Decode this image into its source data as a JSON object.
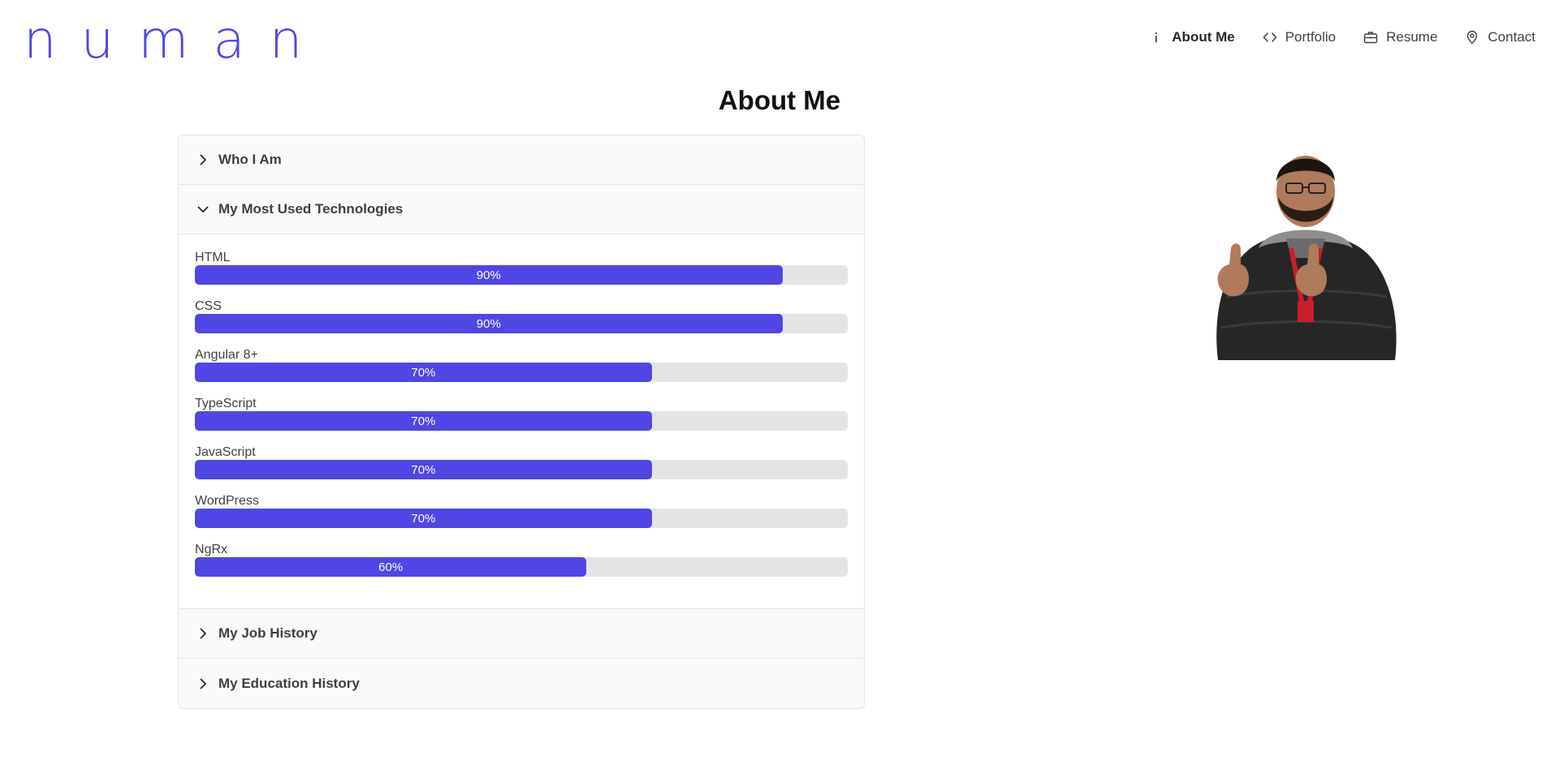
{
  "header": {
    "logo": "numan",
    "nav": [
      {
        "label": "About Me",
        "icon": "info-icon",
        "active": true
      },
      {
        "label": "Portfolio",
        "icon": "code-icon",
        "active": false
      },
      {
        "label": "Resume",
        "icon": "briefcase-icon",
        "active": false
      },
      {
        "label": "Contact",
        "icon": "map-pin-icon",
        "active": false
      }
    ]
  },
  "main": {
    "title": "About Me",
    "sections": [
      {
        "label": "Who I Am",
        "expanded": false
      },
      {
        "label": "My Most Used Technologies",
        "expanded": true
      },
      {
        "label": "My Job History",
        "expanded": false
      },
      {
        "label": "My Education History",
        "expanded": false
      }
    ],
    "skills": [
      {
        "name": "HTML",
        "percent": 90,
        "label": "90%"
      },
      {
        "name": "CSS",
        "percent": 90,
        "label": "90%"
      },
      {
        "name": "Angular 8+",
        "percent": 70,
        "label": "70%"
      },
      {
        "name": "TypeScript",
        "percent": 70,
        "label": "70%"
      },
      {
        "name": "JavaScript",
        "percent": 70,
        "label": "70%"
      },
      {
        "name": "WordPress",
        "percent": 70,
        "label": "70%"
      },
      {
        "name": "NgRx",
        "percent": 60,
        "label": "60%"
      }
    ]
  },
  "colors": {
    "accent": "#4f46e5",
    "track": "#e4e4e7",
    "text": "#3f3f46"
  }
}
